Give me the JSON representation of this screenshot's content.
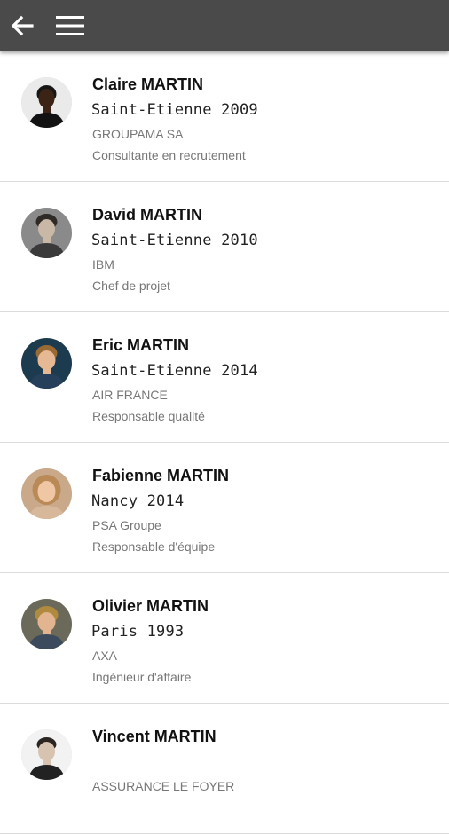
{
  "appbar": {
    "back_icon": "arrow-left-icon",
    "menu_icon": "hamburger-menu-icon",
    "background_color": "#4a4a4a"
  },
  "contacts": [
    {
      "name": "Claire MARTIN",
      "promo": "Saint-Etienne 2009",
      "company": "GROUPAMA SA",
      "job": "Consultante en recrutement",
      "avatar": {
        "bg": "#eaeaea",
        "skin": "#3b2415",
        "hair": "#161616",
        "shirt": "#121212"
      }
    },
    {
      "name": "David MARTIN",
      "promo": "Saint-Etienne 2010",
      "company": "IBM",
      "job": "Chef de projet",
      "avatar": {
        "bg": "#8a8a8a",
        "skin": "#c9b8a6",
        "hair": "#2e2a26",
        "shirt": "#3a3a3a"
      }
    },
    {
      "name": "Eric MARTIN",
      "promo": "Saint-Etienne 2014",
      "company": "AIR FRANCE",
      "job": "Responsable qualité",
      "avatar": {
        "bg": "#1d3b4f",
        "skin": "#e6b894",
        "hair": "#9a6a35",
        "shirt": "#263f5a"
      }
    },
    {
      "name": "Fabienne MARTIN",
      "promo": "Nancy 2014",
      "company": "PSA Groupe",
      "job": "Responsable d'équipe",
      "avatar": {
        "bg": "#c9a98a",
        "skin": "#f0c7a4",
        "hair": "#b98a55",
        "shirt": "#d8b89a"
      }
    },
    {
      "name": "Olivier MARTIN",
      "promo": "Paris 1993",
      "company": "AXA",
      "job": "Ingénieur d'affaire",
      "avatar": {
        "bg": "#6b6a5a",
        "skin": "#e2b48f",
        "hair": "#b08a3e",
        "shirt": "#3c4a5e"
      }
    },
    {
      "name": "Vincent MARTIN",
      "promo": "",
      "company": "ASSURANCE LE FOYER",
      "job": "",
      "avatar": {
        "bg": "#f2f2f2",
        "skin": "#d8c2b0",
        "hair": "#2b2622",
        "shirt": "#222222"
      }
    }
  ]
}
